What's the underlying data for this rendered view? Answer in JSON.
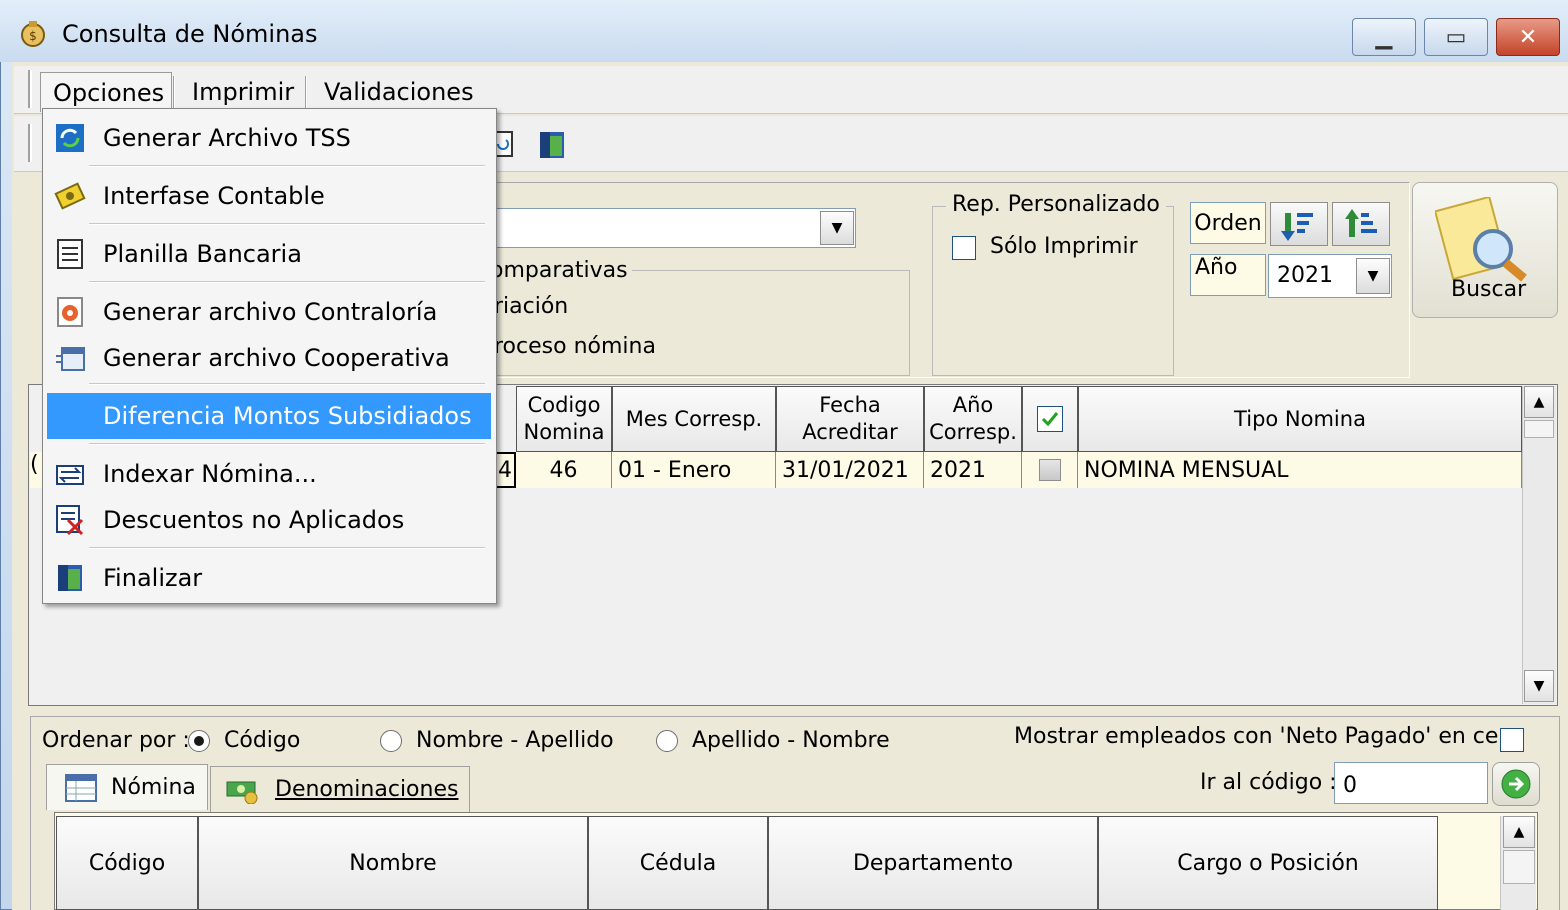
{
  "window": {
    "title": "Consulta de Nóminas",
    "minimize": "▁",
    "maximize": "▭",
    "close": "✕"
  },
  "menubar": {
    "items": [
      "Opciones",
      "Imprimir",
      "Validaciones"
    ]
  },
  "dropdown_menu": {
    "items": [
      {
        "label": "Generar Archivo TSS",
        "icon": "refresh-globe-icon"
      },
      {
        "label": "Interfase Contable",
        "icon": "ledger-icon"
      },
      {
        "label": "Planilla Bancaria",
        "icon": "spreadsheet-icon"
      },
      {
        "label": "Generar archivo Contraloría",
        "icon": "gear-doc-icon"
      },
      {
        "label": "Generar archivo Cooperativa",
        "icon": "calendar-doc-icon"
      },
      {
        "label": "Diferencia Montos Subsidiados",
        "icon": ""
      },
      {
        "label": "Indexar Nómina...",
        "icon": "index-arrows-icon"
      },
      {
        "label": "Descuentos no Aplicados",
        "icon": "cancel-list-icon"
      },
      {
        "label": "Finalizar",
        "icon": "exit-door-icon"
      }
    ],
    "highlighted": "Diferencia Montos Subsidiados"
  },
  "filters": {
    "comparativas_label": "omparativas",
    "option_variacion": "riación",
    "option_proceso": "roceso nómina",
    "rep_personalizado_label": "Rep. Personalizado",
    "solo_imprimir_label": "Sólo Imprimir",
    "orden_label": "Orden",
    "anio_label": "Año",
    "anio_value": "2021",
    "buscar_label": "Buscar"
  },
  "payroll_table": {
    "headers": [
      "Codigo\nNomina",
      "Mes Corresp.",
      "Fecha\nAcreditar",
      "Año\nCorresp.",
      "",
      "Tipo Nomina"
    ],
    "row": {
      "cut_left": "4",
      "codigo": "46",
      "mes": "01 - Enero",
      "fecha": "31/01/2021",
      "anio": "2021",
      "tipo": "NOMINA MENSUAL"
    },
    "row_left_fragment": "("
  },
  "bottom": {
    "ordenar_label": "Ordenar por :",
    "radio_codigo": "Código",
    "radio_nombre_apellido": "Nombre - Apellido",
    "radio_apellido_nombre": "Apellido - Nombre",
    "mostrar_label": "Mostrar empleados con 'Neto Pagado' en cero",
    "tab_nomina": "Nómina",
    "tab_denominaciones": "Denominaciones",
    "ir_codigo_label": "Ir al código :",
    "ir_codigo_value": "0",
    "headers": [
      "Código",
      "Nombre",
      "Cédula",
      "Departamento",
      "Cargo o Posición"
    ]
  },
  "colors": {
    "highlight": "#3399ff",
    "row_bg": "#fdfbe6",
    "close_red": "#c4442a"
  }
}
